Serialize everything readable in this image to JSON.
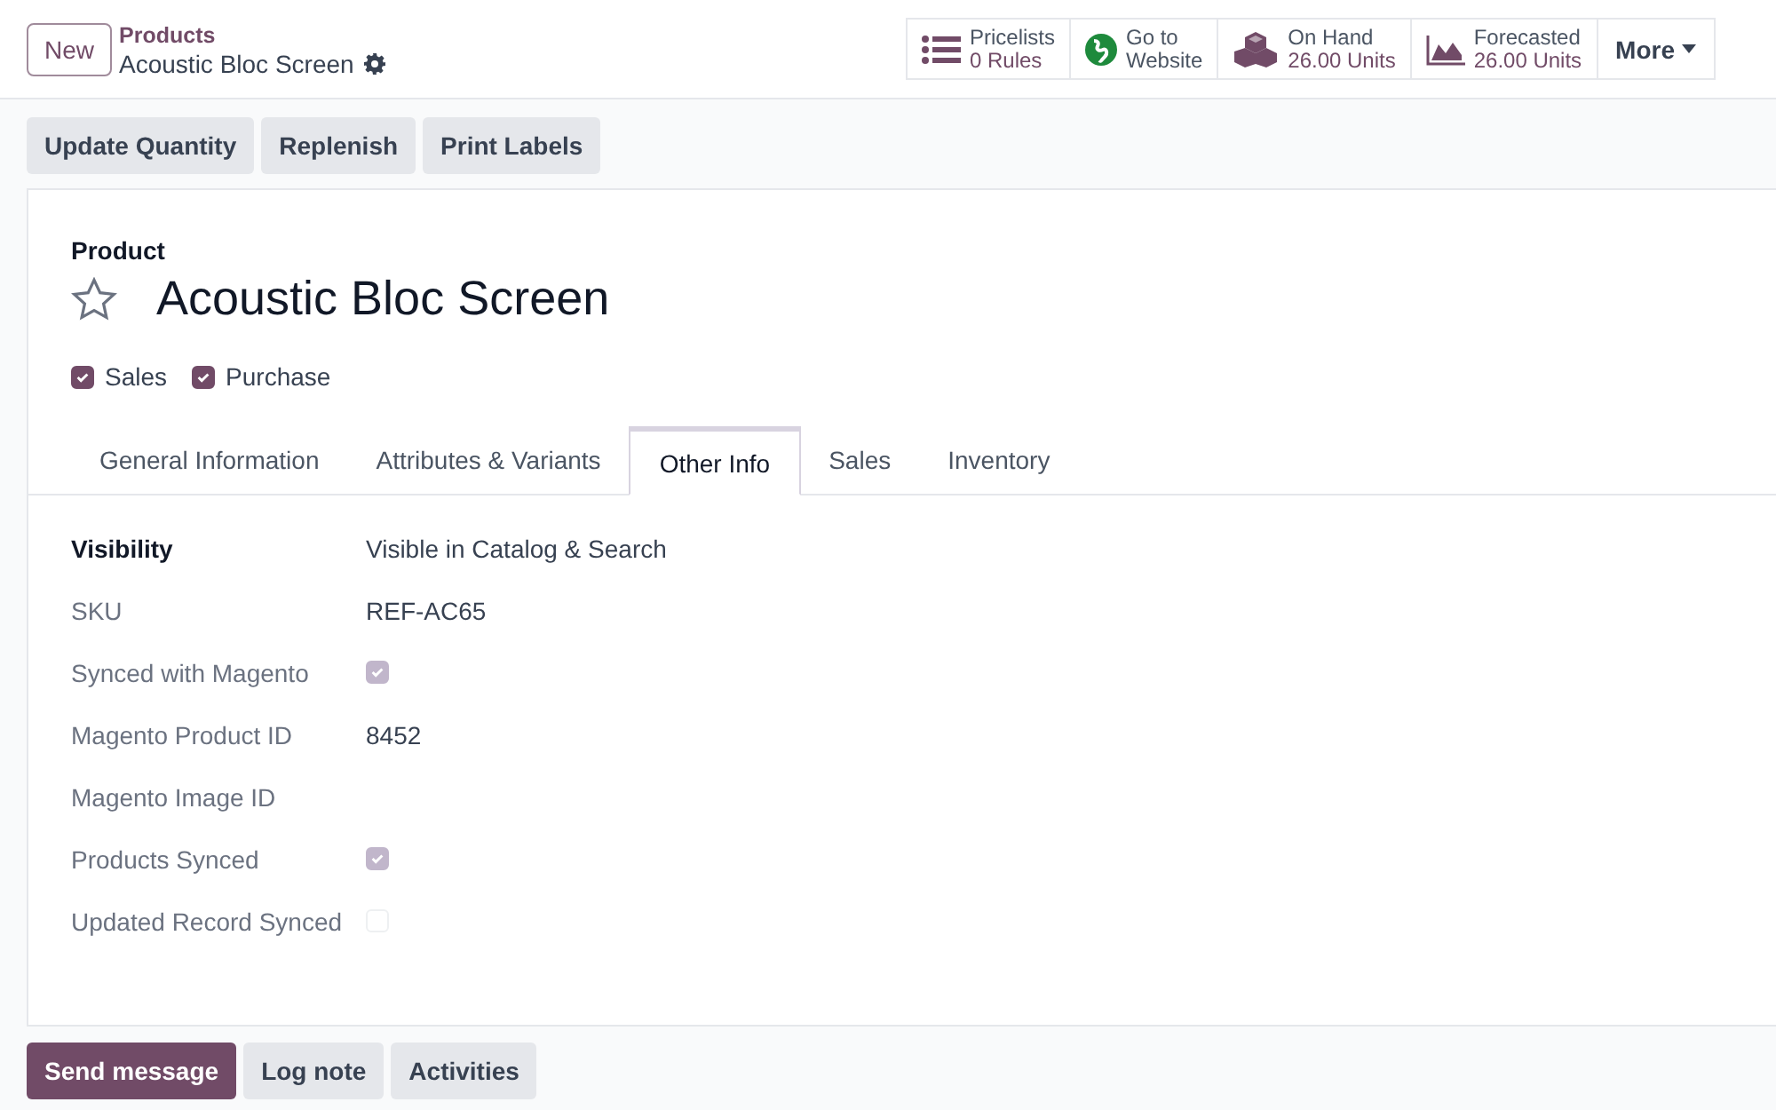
{
  "control_panel": {
    "new_button": "New",
    "breadcrumb": "Products",
    "record_title": "Acoustic Bloc Screen",
    "stat_buttons": [
      {
        "kind": "list",
        "label": "Pricelists",
        "value": "0 Rules"
      },
      {
        "kind": "globe",
        "label": "Go to",
        "value": "Website"
      },
      {
        "kind": "cubes",
        "label": "On Hand",
        "value": "26.00 Units"
      },
      {
        "kind": "chart",
        "label": "Forecasted",
        "value": "26.00 Units"
      }
    ],
    "more_button": "More"
  },
  "action_buttons": [
    "Update Quantity",
    "Replenish",
    "Print Labels"
  ],
  "form": {
    "caption": "Product",
    "favorite": false,
    "name": "Acoustic Bloc Screen",
    "options": [
      {
        "label": "Sales",
        "checked": true
      },
      {
        "label": "Purchase",
        "checked": true
      }
    ],
    "tabs": [
      {
        "label": "General Information",
        "selected": false
      },
      {
        "label": "Attributes & Variants",
        "selected": false
      },
      {
        "label": "Other Info",
        "selected": true
      },
      {
        "label": "Sales",
        "selected": false
      },
      {
        "label": "Inventory",
        "selected": false
      }
    ],
    "fields": [
      {
        "label": "Visibility",
        "required": true,
        "kind": "text",
        "value": "Visible in Catalog & Search"
      },
      {
        "label": "SKU",
        "required": false,
        "kind": "text",
        "value": "REF-AC65"
      },
      {
        "label": "Synced with Magento",
        "required": false,
        "kind": "checkbox",
        "checked": true
      },
      {
        "label": "Magento Product ID",
        "required": false,
        "kind": "text",
        "value": "8452"
      },
      {
        "label": "Magento Image ID",
        "required": false,
        "kind": "empty"
      },
      {
        "label": "Products Synced",
        "required": false,
        "kind": "checkbox",
        "checked": true
      },
      {
        "label": "Updated Record Synced",
        "required": false,
        "kind": "checkbox",
        "checked": false
      }
    ]
  },
  "chatter_buttons": [
    {
      "label": "Send message",
      "selected": true
    },
    {
      "label": "Log note",
      "selected": false
    },
    {
      "label": "Activities",
      "selected": false
    }
  ]
}
